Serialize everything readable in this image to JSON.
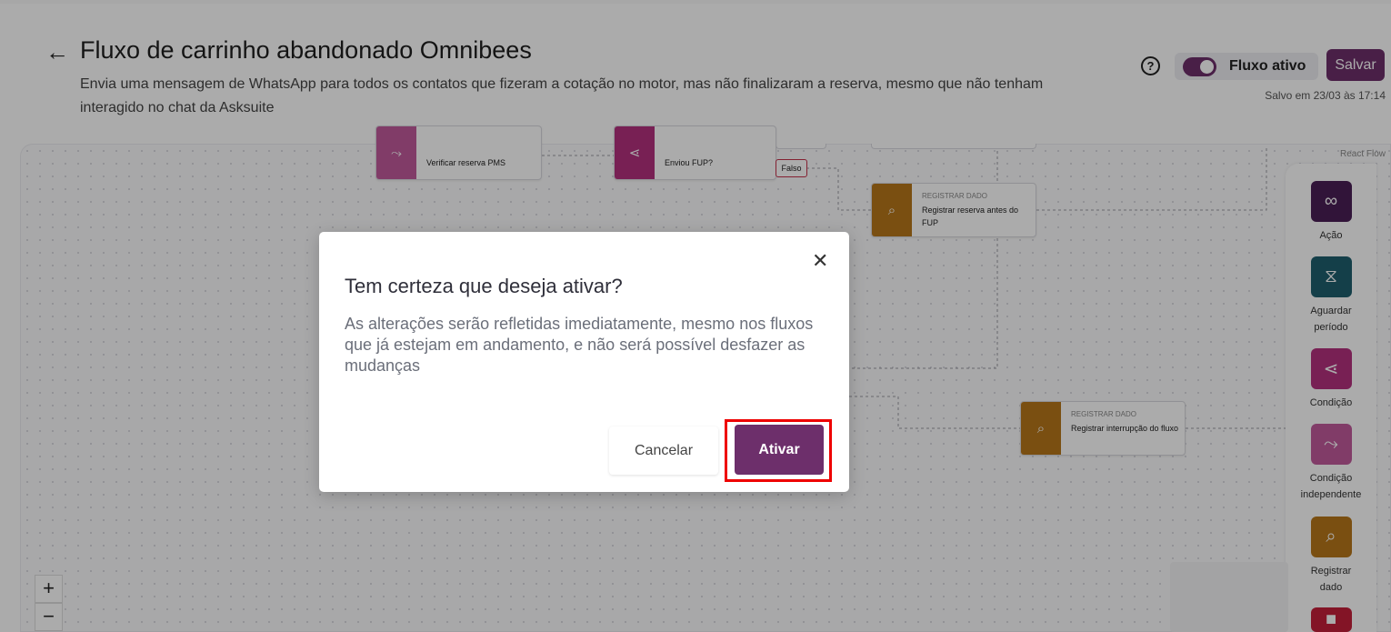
{
  "header": {
    "title": "Fluxo de carrinho abandonado Omnibees",
    "description": "Envia uma mensagem de WhatsApp para todos os contatos que fizeram a cotação no motor, mas não finalizaram a reserva, mesmo que não tenham interagido no chat da Asksuite",
    "toggle_label": "Fluxo ativo",
    "toggle_on": true,
    "save_label": "Salvar",
    "saved_at": "Salvo em 23/03 às 17:14",
    "help_glyph": "?",
    "back_glyph": "←"
  },
  "canvas": {
    "react_flow_label": "React Flow",
    "nodes": [
      {
        "kind": "",
        "text": "Verificar reserva PMS",
        "icon": "split-icon"
      },
      {
        "kind": "",
        "text": "Enviou FUP?",
        "icon": "branch-icon"
      },
      {
        "kind": "REGISTRAR DADO",
        "text": "Registrar reserva antes do FUP",
        "icon": "chart-search-icon"
      },
      {
        "kind": "REGISTRAR DADO",
        "text": "Registrar interrupção do fluxo",
        "icon": "chart-search-icon"
      }
    ],
    "falso_label": "Falso",
    "zoom_in": "+",
    "zoom_out": "−"
  },
  "palette": [
    {
      "label": "Ação",
      "icon": "footprints-icon",
      "color": "#4a1e55"
    },
    {
      "label": "Aguardar período",
      "icon": "hourglass-icon",
      "color": "#1f5f6e"
    },
    {
      "label": "Condição",
      "icon": "branch-icon",
      "color": "#b4317e"
    },
    {
      "label": "Condição independente",
      "icon": "split-icon",
      "color": "#c05a9c"
    },
    {
      "label": "Registrar dado",
      "icon": "chart-search-icon",
      "color": "#b7771a"
    }
  ],
  "modal": {
    "title": "Tem certeza que deseja ativar?",
    "body": "As alterações serão refletidas imediatamente, mesmo nos fluxos que já estejam em andamento, e não será possível desfazer as mudanças",
    "cancel_label": "Cancelar",
    "confirm_label": "Ativar",
    "close_glyph": "✕"
  },
  "colors": {
    "primary": "#6d2f6b",
    "highlight": "#ee0000"
  }
}
